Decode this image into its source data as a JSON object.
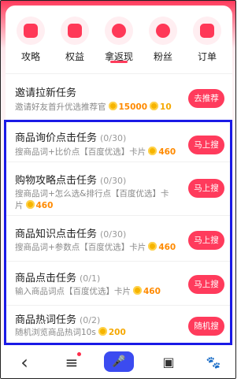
{
  "categories": [
    {
      "label": "攻略",
      "icon": "video-play-icon"
    },
    {
      "label": "权益",
      "icon": "crown-icon"
    },
    {
      "label": "拿返现",
      "icon": "cashback-icon"
    },
    {
      "label": "粉丝",
      "icon": "fans-avatar-icon"
    },
    {
      "label": "订单",
      "icon": "order-list-icon"
    }
  ],
  "active_category": "拿返现",
  "invite": {
    "title": "邀请拉新任务",
    "desc": "邀请好友首升优选推荐官",
    "reward1": "15000",
    "reward2": "10",
    "button": "去推荐"
  },
  "tasks": [
    {
      "title": "商品询价点击任务",
      "progress": "(0/30)",
      "desc": "搜商品词+比价点【百度优选】卡片",
      "reward": "460",
      "button": "马上搜"
    },
    {
      "title": "购物攻略点击任务",
      "progress": "(0/30)",
      "desc": "搜商品词+怎么选&排行点【百度优选】卡片",
      "reward": "460",
      "button": "马上搜"
    },
    {
      "title": "商品知识点击任务",
      "progress": "(0/30)",
      "desc": "搜商品词+参数点【百度优选】卡片",
      "reward": "460",
      "button": "马上搜"
    },
    {
      "title": "商品点击任务",
      "progress": "(0/1)",
      "desc": "输入商品词点【百度优选】卡片",
      "reward": "460",
      "button": "马上搜"
    },
    {
      "title": "商品热词任务",
      "progress": "(0/2)",
      "desc": "随机浏览商品热词10s",
      "reward": "200",
      "button": "随机搜"
    }
  ],
  "bottom_nav": [
    {
      "icon": "back-arrow-icon",
      "glyph": "‹"
    },
    {
      "icon": "menu-icon",
      "glyph": "≡"
    },
    {
      "icon": "microphone-icon",
      "glyph": "🎤"
    },
    {
      "icon": "tabs-icon",
      "glyph": "▣"
    },
    {
      "icon": "paw-icon",
      "glyph": "🐾"
    }
  ],
  "colors": {
    "accent": "#ff3b5c",
    "coin": "#f6b400",
    "highlight": "#1a1ae6",
    "mic": "#3b4bf0"
  }
}
